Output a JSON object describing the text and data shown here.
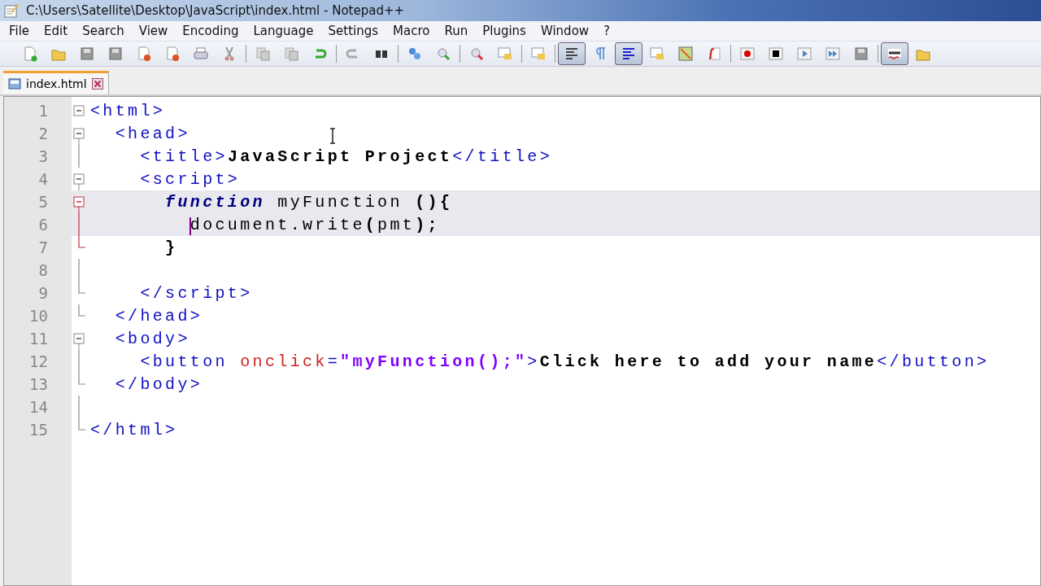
{
  "window": {
    "title": "C:\\Users\\Satellite\\Desktop\\JavaScript\\index.html - Notepad++"
  },
  "menu": [
    "File",
    "Edit",
    "Search",
    "View",
    "Encoding",
    "Language",
    "Settings",
    "Macro",
    "Run",
    "Plugins",
    "Window",
    "?"
  ],
  "toolbar": [
    {
      "on": false
    },
    {
      "on": false
    },
    {
      "on": false
    },
    {
      "on": false
    },
    {
      "on": false
    },
    {
      "on": false
    },
    {
      "on": false
    },
    {
      "on": false
    },
    {
      "on": false
    },
    {
      "on": false
    },
    {
      "on": false
    },
    {
      "on": false
    },
    {
      "on": false
    },
    {
      "on": false
    },
    {
      "on": false
    },
    {
      "on": false
    },
    {
      "on": false
    },
    {
      "on": false
    },
    {
      "on": true
    },
    {
      "on": false
    },
    {
      "on": true
    },
    {
      "on": false
    },
    {
      "on": false
    },
    {
      "on": false
    },
    {
      "on": false
    },
    {
      "on": false
    },
    {
      "on": false
    },
    {
      "on": false
    },
    {
      "on": false
    },
    {
      "on": true
    },
    {
      "on": false
    }
  ],
  "tabs": [
    {
      "label": "index.html",
      "selected": true
    }
  ],
  "lines": [
    {
      "number": "1",
      "kind": "open",
      "highlighted": false,
      "caret": false,
      "tokens": [
        {
          "kind": "tag",
          "text": "<html>"
        }
      ]
    },
    {
      "number": "2",
      "kind": "open",
      "highlighted": false,
      "caret": false,
      "tokens": [
        {
          "kind": "tag",
          "text": "  <head>"
        }
      ]
    },
    {
      "number": "3",
      "kind": "line",
      "highlighted": false,
      "caret": false,
      "tokens": [
        {
          "kind": "tag",
          "text": "    <title>"
        },
        {
          "kind": "text",
          "text": "JavaScript Project"
        },
        {
          "kind": "tag",
          "text": "</title>"
        }
      ]
    },
    {
      "number": "4",
      "kind": "open",
      "highlighted": false,
      "caret": false,
      "tokens": [
        {
          "kind": "tag",
          "text": "    <script>"
        }
      ]
    },
    {
      "number": "5",
      "kind": "activeopen",
      "highlighted": true,
      "caret": false,
      "tokens": [
        {
          "kind": "keyword",
          "text": "      function"
        },
        {
          "kind": "plain",
          "text": " myFunction "
        },
        {
          "kind": "punct",
          "text": "(){"
        }
      ]
    },
    {
      "number": "6",
      "kind": "activeline",
      "highlighted": true,
      "caret": true,
      "tokens": [
        {
          "kind": "plain",
          "text": "        document.write"
        },
        {
          "kind": "punct",
          "text": "("
        },
        {
          "kind": "plain",
          "text": "pmt"
        },
        {
          "kind": "punct",
          "text": ");"
        }
      ]
    },
    {
      "number": "7",
      "kind": "activeend",
      "highlighted": false,
      "caret": false,
      "tokens": [
        {
          "kind": "punct",
          "text": "      }"
        }
      ]
    },
    {
      "number": "8",
      "kind": "line",
      "highlighted": false,
      "caret": false
    },
    {
      "number": "9",
      "kind": "end",
      "highlighted": false,
      "caret": false,
      "tokens": [
        {
          "kind": "tag",
          "text": "    </script>"
        }
      ]
    },
    {
      "number": "10",
      "kind": "end",
      "highlighted": false,
      "caret": false,
      "tokens": [
        {
          "kind": "tag",
          "text": "  </head>"
        }
      ]
    },
    {
      "number": "11",
      "kind": "open",
      "highlighted": false,
      "caret": false,
      "tokens": [
        {
          "kind": "tag",
          "text": "  <body>"
        }
      ]
    },
    {
      "number": "12",
      "kind": "line",
      "highlighted": false,
      "caret": false,
      "tokens": [
        {
          "kind": "tag",
          "text": "    <button "
        },
        {
          "kind": "attr",
          "text": "onclick"
        },
        {
          "kind": "tag",
          "text": "="
        },
        {
          "kind": "string",
          "text": "\"myFunction();\""
        },
        {
          "kind": "tag",
          "text": ">"
        },
        {
          "kind": "text",
          "text": "Click here to add your name"
        },
        {
          "kind": "tag",
          "text": "</button>"
        }
      ]
    },
    {
      "number": "13",
      "kind": "end",
      "highlighted": false,
      "caret": false,
      "tokens": [
        {
          "kind": "tag",
          "text": "  </body>"
        }
      ]
    },
    {
      "number": "14",
      "kind": "line",
      "highlighted": false,
      "caret": false
    },
    {
      "number": "15",
      "kind": "end",
      "highlighted": false,
      "caret": false,
      "tokens": [
        {
          "kind": "tag",
          "text": "</html>"
        }
      ]
    }
  ]
}
